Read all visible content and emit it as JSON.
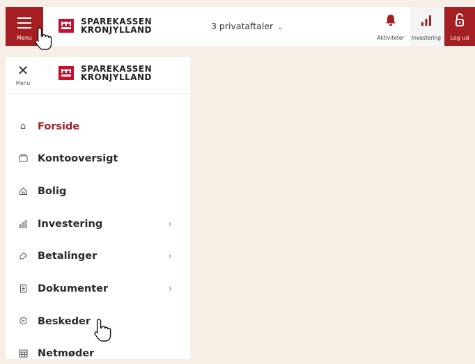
{
  "topbar": {
    "menu_label": "Menu",
    "logo_line1": "SPAREKASSEN",
    "logo_line2": "KRONJYLLAND",
    "agreements_label": "3 privataftaler",
    "activities_label": "Aktiviteter",
    "investing_label": "Investering",
    "logout_label": "Log ud"
  },
  "sidemenu": {
    "close_label": "Menu",
    "logo_line1": "SPAREKASSEN",
    "logo_line2": "KRONJYLLAND",
    "items": [
      {
        "label": "Forside",
        "icon": "home-icon",
        "active": true
      },
      {
        "label": "Kontooversigt",
        "icon": "wallet-icon"
      },
      {
        "label": "Bolig",
        "icon": "house-icon"
      },
      {
        "label": "Investering",
        "icon": "chart-bars-icon",
        "submenu": true
      },
      {
        "label": "Betalinger",
        "icon": "tag-icon",
        "submenu": true
      },
      {
        "label": "Dokumenter",
        "icon": "document-icon",
        "submenu": true
      },
      {
        "label": "Beskeder",
        "icon": "chat-bubble-icon"
      },
      {
        "label": "Netmøder",
        "icon": "calendar-icon"
      }
    ]
  },
  "colors": {
    "brand_red": "#a51e22",
    "background": "#f7efe6"
  }
}
